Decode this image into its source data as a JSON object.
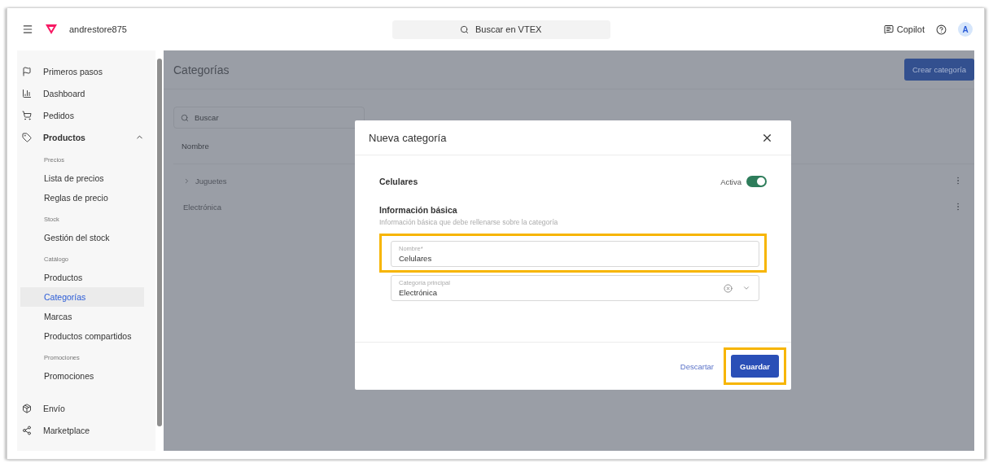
{
  "header": {
    "store_name": "andrestore875",
    "search": {
      "placeholder": "Buscar en VTEX"
    },
    "copilot": "Copilot",
    "avatar": "A"
  },
  "sidebar": {
    "items": [
      {
        "label": "Primeros pasos"
      },
      {
        "label": "Dashboard"
      },
      {
        "label": "Pedidos"
      },
      {
        "label": "Productos",
        "expanded": true,
        "sections": [
          {
            "title": "Precios",
            "items": [
              {
                "label": "Lista de precios",
                "selected": false
              },
              {
                "label": "Reglas de precio",
                "selected": false
              }
            ]
          },
          {
            "title": "Stock",
            "items": [
              {
                "label": "Gestión del stock",
                "selected": false
              }
            ]
          },
          {
            "title": "Catálogo",
            "items": [
              {
                "label": "Productos",
                "selected": false
              },
              {
                "label": "Categorías",
                "selected": true
              },
              {
                "label": "Marcas",
                "selected": false
              },
              {
                "label": "Productos compartidos",
                "selected": false
              }
            ]
          },
          {
            "title": "Promociones",
            "items": [
              {
                "label": "Promociones",
                "selected": false
              }
            ]
          }
        ]
      },
      {
        "label": "Envío"
      },
      {
        "label": "Marketplace"
      }
    ]
  },
  "page": {
    "title": "Categorías",
    "create_button": "Crear categoría",
    "search": {
      "placeholder": "Buscar"
    },
    "table": {
      "columns": [
        "Nombre"
      ],
      "rows": [
        {
          "name": "Juguetes",
          "expandable": true
        },
        {
          "name": "Electrónica",
          "expandable": false
        }
      ]
    }
  },
  "modal": {
    "title": "Nueva categoría",
    "category_name": "Celulares",
    "toggle": {
      "label": "Activa",
      "on": true
    },
    "section_title": "Información básica",
    "section_description": "Información básica que debe rellenarse sobre la categoría",
    "fields": [
      {
        "kind": "text",
        "label": "Nombre*",
        "value": "Celulares",
        "highlighted": true
      },
      {
        "kind": "select",
        "label": "Categoría principal",
        "value": "Electrónica",
        "highlighted": false
      }
    ],
    "discard": "Descartar",
    "save": {
      "label": "Guardar",
      "highlighted": true
    }
  }
}
